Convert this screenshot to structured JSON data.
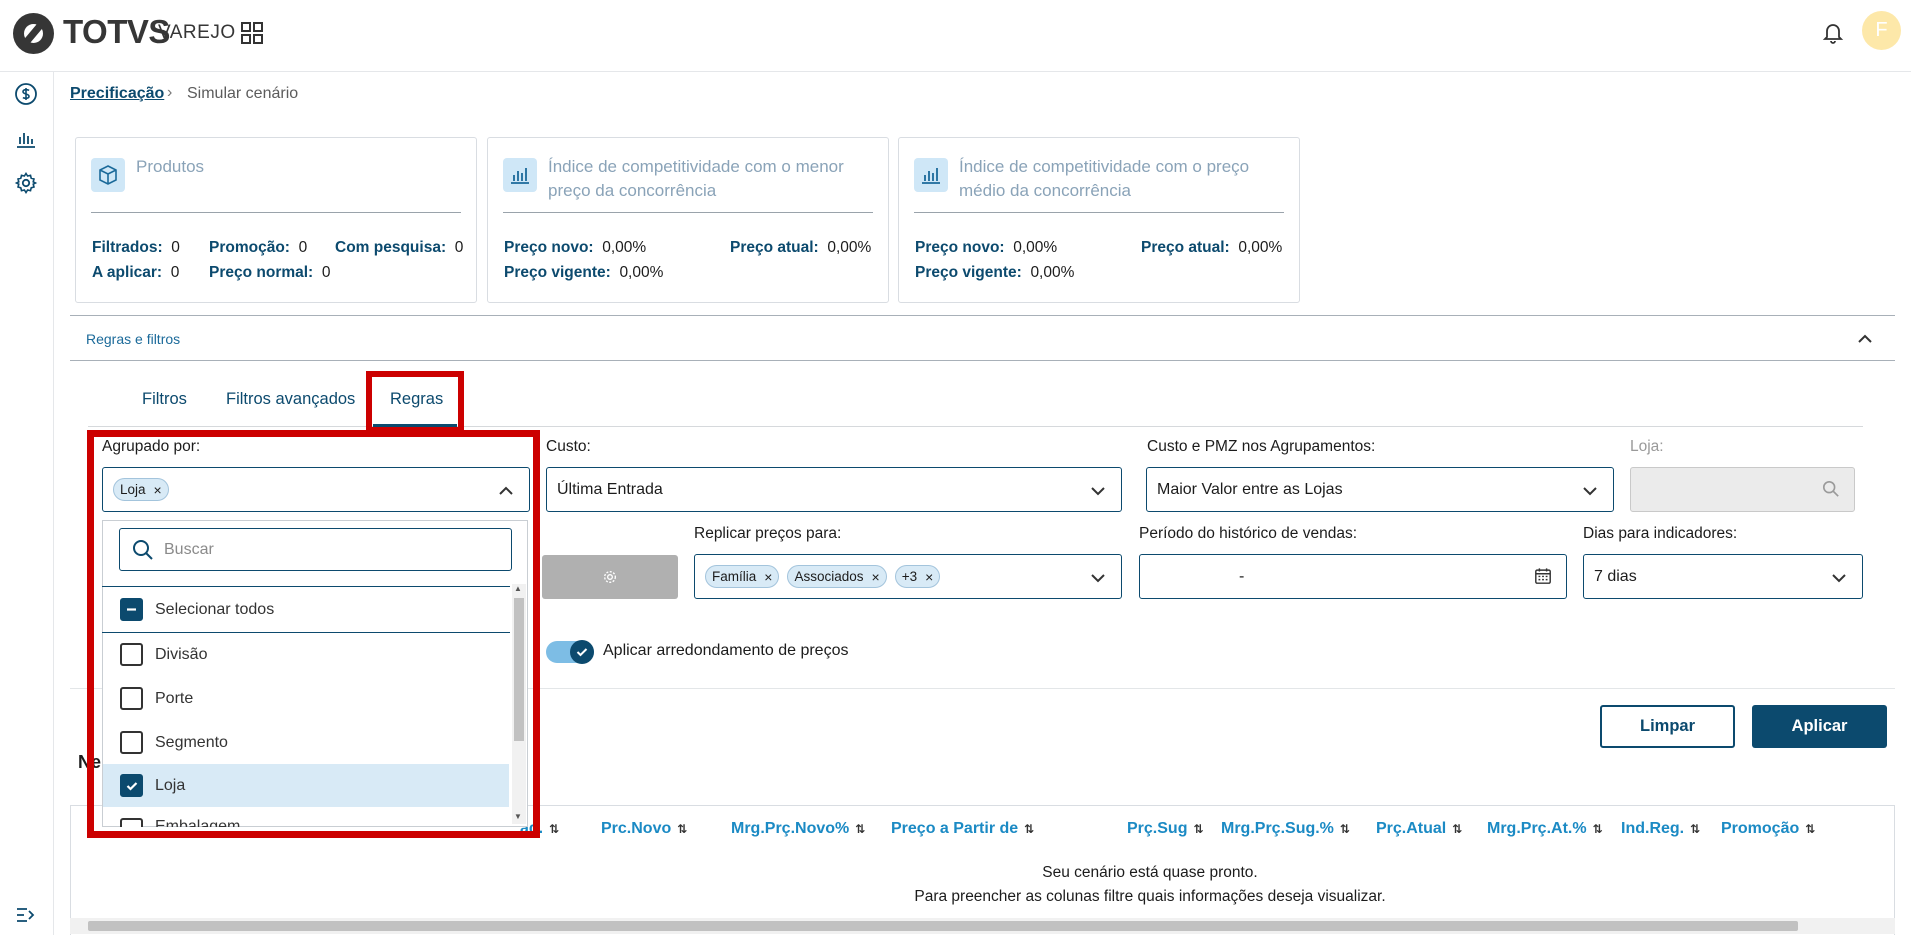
{
  "header": {
    "logo": "TOTVS",
    "logo_sub": "VAREJO",
    "avatar_initial": "F"
  },
  "breadcrumb": {
    "parent": "Precificação",
    "separator": "›",
    "current": "Simular cenário"
  },
  "cards": [
    {
      "title_line1": "Produtos",
      "title_line2": "",
      "rows": [
        {
          "label": "Filtrados:",
          "value": "0"
        },
        {
          "label": "Promoção:",
          "value": "0"
        },
        {
          "label": "Com pesquisa:",
          "value": "0"
        },
        {
          "label": "A aplicar:",
          "value": "0"
        },
        {
          "label": "Preço normal:",
          "value": "0"
        }
      ]
    },
    {
      "title_line1": "Índice de competitividade com o menor",
      "title_line2": "preço da concorrência",
      "rows": [
        {
          "label": "Preço novo:",
          "value": "0,00%"
        },
        {
          "label": "Preço atual:",
          "value": "0,00%"
        },
        {
          "label": "Preço vigente:",
          "value": "0,00%"
        }
      ]
    },
    {
      "title_line1": "Índice de competitividade com o preço",
      "title_line2": "médio da concorrência",
      "rows": [
        {
          "label": "Preço novo:",
          "value": "0,00%"
        },
        {
          "label": "Preço atual:",
          "value": "0,00%"
        },
        {
          "label": "Preço vigente:",
          "value": "0,00%"
        }
      ]
    }
  ],
  "accordion": {
    "title": "Regras e filtros"
  },
  "tabs": [
    {
      "label": "Filtros"
    },
    {
      "label": "Filtros avançados"
    },
    {
      "label": "Regras"
    }
  ],
  "form": {
    "agrupado": {
      "label": "Agrupado por:",
      "chip": "Loja",
      "chip_remove": "×"
    },
    "custo": {
      "label": "Custo:",
      "value": "Última Entrada"
    },
    "custo_pmz": {
      "label": "Custo e PMZ nos Agrupamentos:",
      "value": "Maior Valor entre as Lojas"
    },
    "loja": {
      "label": "Loja:"
    },
    "replicar": {
      "label": "Replicar preços para:",
      "chips": [
        "Família",
        "Associados",
        "+3"
      ],
      "chip_remove": "×"
    },
    "periodo": {
      "label": "Período do histórico de vendas:",
      "value": "-"
    },
    "dias": {
      "label": "Dias para indicadores:",
      "value": "7 dias"
    },
    "arredondamento": {
      "label": "Aplicar arredondamento de preços",
      "checked": true
    }
  },
  "actions": {
    "clear": "Limpar",
    "apply": "Aplicar"
  },
  "dropdown": {
    "search_placeholder": "Buscar",
    "select_all": "Selecionar todos",
    "options": [
      {
        "label": "Divisão",
        "checked": false
      },
      {
        "label": "Porte",
        "checked": false
      },
      {
        "label": "Segmento",
        "checked": false
      },
      {
        "label": "Loja",
        "checked": true
      },
      {
        "label": "Embalagem",
        "checked": false
      }
    ]
  },
  "table": {
    "section_title": "Ne",
    "columns": [
      "ad.",
      "Prc.Novo",
      "Mrg.Prç.Novo%",
      "Preço a Partir de",
      "Prç.Sug",
      "Mrg.Prç.Sug.%",
      "Prç.Atual",
      "Mrg.Prç.At.%",
      "Ind.Reg.",
      "Promoção"
    ],
    "sort_glyph": "⇅",
    "empty_line1": "Seu cenário está quase pronto.",
    "empty_line2": "Para preencher as colunas filtre quais informações deseja visualizar."
  }
}
